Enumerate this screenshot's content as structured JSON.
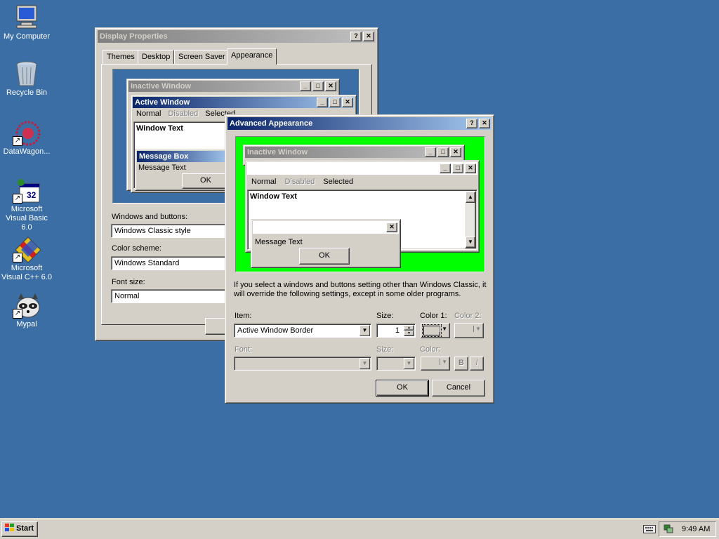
{
  "desktop": {
    "icons": [
      {
        "label": "My Computer",
        "icon": "my-computer-icon"
      },
      {
        "label": "Recycle Bin",
        "icon": "recycle-bin-icon"
      },
      {
        "label": "DataWagon...",
        "icon": "datawagon-icon"
      },
      {
        "label": "Microsoft Visual Basic 6.0",
        "icon": "visual-basic-icon"
      },
      {
        "label": "Microsoft Visual C++ 6.0",
        "icon": "visual-cpp-icon"
      },
      {
        "label": "Mypal",
        "icon": "mypal-icon"
      }
    ]
  },
  "display_properties": {
    "title": "Display Properties",
    "tabs": [
      "Themes",
      "Desktop",
      "Screen Saver",
      "Appearance"
    ],
    "selected_tab": "Appearance",
    "preview": {
      "inactive_title": "Inactive Window",
      "active_title": "Active Window",
      "menu": [
        "Normal",
        "Disabled",
        "Selected"
      ],
      "window_text": "Window Text",
      "msgbox_title": "Message Box",
      "msgbox_text": "Message Text",
      "ok": "OK"
    },
    "windows_buttons_label": "Windows and buttons:",
    "windows_buttons_value": "Windows Classic style",
    "color_scheme_label": "Color scheme:",
    "color_scheme_value": "Windows Standard",
    "font_size_label": "Font size:",
    "font_size_value": "Normal"
  },
  "advanced": {
    "title": "Advanced Appearance",
    "preview_bg": "#00ff00",
    "preview": {
      "inactive_title": "Inactive Window",
      "menu": [
        "Normal",
        "Disabled",
        "Selected"
      ],
      "window_text": "Window Text",
      "msgbox_text": "Message Text",
      "ok": "OK"
    },
    "note": "If you select a windows and buttons setting other than Windows Classic, it will override the following settings, except in some older programs.",
    "item_label": "Item:",
    "item_value": "Active Window Border",
    "size_label": "Size:",
    "size_value": "1",
    "color1_label": "Color 1:",
    "color2_label": "Color 2:",
    "font_label": "Font:",
    "font_size_label": "Size:",
    "font_color_label": "Color:",
    "bold": "B",
    "italic": "I",
    "ok": "OK",
    "cancel": "Cancel"
  },
  "taskbar": {
    "start": "Start",
    "time": "9:49 AM"
  }
}
